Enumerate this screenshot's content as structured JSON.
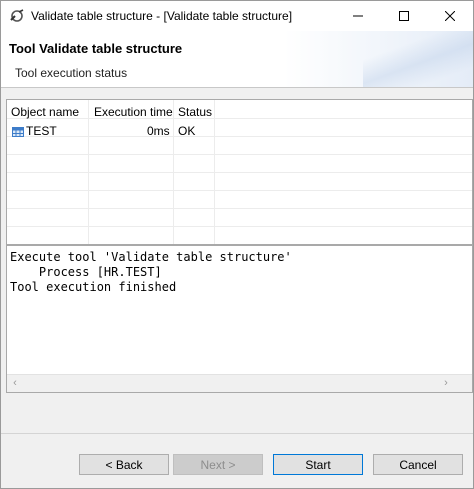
{
  "window": {
    "title": "Validate table structure - [Validate table structure]"
  },
  "header": {
    "title": "Tool Validate table structure",
    "description": "Tool execution status"
  },
  "table": {
    "columns": [
      "Object name",
      "Execution time",
      "Status"
    ],
    "rows": [
      {
        "object_name": "TEST",
        "execution_time": "0ms",
        "status": "OK",
        "icon": "table-icon"
      }
    ]
  },
  "log": {
    "lines": [
      "Execute tool 'Validate table structure'",
      "    Process [HR.TEST]",
      "Tool execution finished"
    ]
  },
  "buttons": {
    "back": "< Back",
    "next": "Next >",
    "start": "Start",
    "cancel": "Cancel"
  },
  "icons": {
    "app": "tool-icon",
    "minimize": "minimize-icon",
    "maximize": "maximize-icon",
    "close": "close-icon"
  }
}
